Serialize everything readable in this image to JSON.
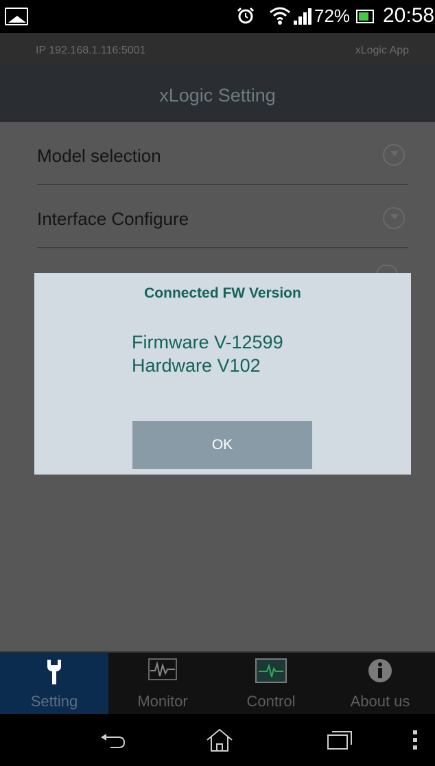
{
  "status_bar": {
    "battery_percent": "72%",
    "time": "20:58",
    "icons": [
      "image-icon",
      "alarm-icon",
      "wifi-icon",
      "signal-icon",
      "battery-icon"
    ]
  },
  "info_bar": {
    "ip": "IP 192.168.1.116:5001",
    "app_name": "xLogic App"
  },
  "header": {
    "title": "xLogic Setting"
  },
  "settings": {
    "items": [
      {
        "label": "Model selection"
      },
      {
        "label": "Interface Configure"
      }
    ]
  },
  "dialog": {
    "title": "Connected FW Version",
    "firmware": "Firmware V-12599",
    "hardware": "Hardware V102",
    "ok_label": "OK"
  },
  "tabs": [
    {
      "label": "Setting",
      "icon": "wrench-icon",
      "active": true
    },
    {
      "label": "Monitor",
      "icon": "waveform-icon",
      "active": false
    },
    {
      "label": "Control",
      "icon": "screen-icon",
      "active": false
    },
    {
      "label": "About us",
      "icon": "info-icon",
      "active": false
    }
  ],
  "nav": {
    "icons": [
      "back-icon",
      "home-icon",
      "recents-icon",
      "menu-icon"
    ]
  },
  "colors": {
    "accent_text": "#14635b",
    "dialog_bg": "#d2dbe2",
    "ok_button": "#8a9ba8",
    "active_tab": "#0b2c4e"
  }
}
